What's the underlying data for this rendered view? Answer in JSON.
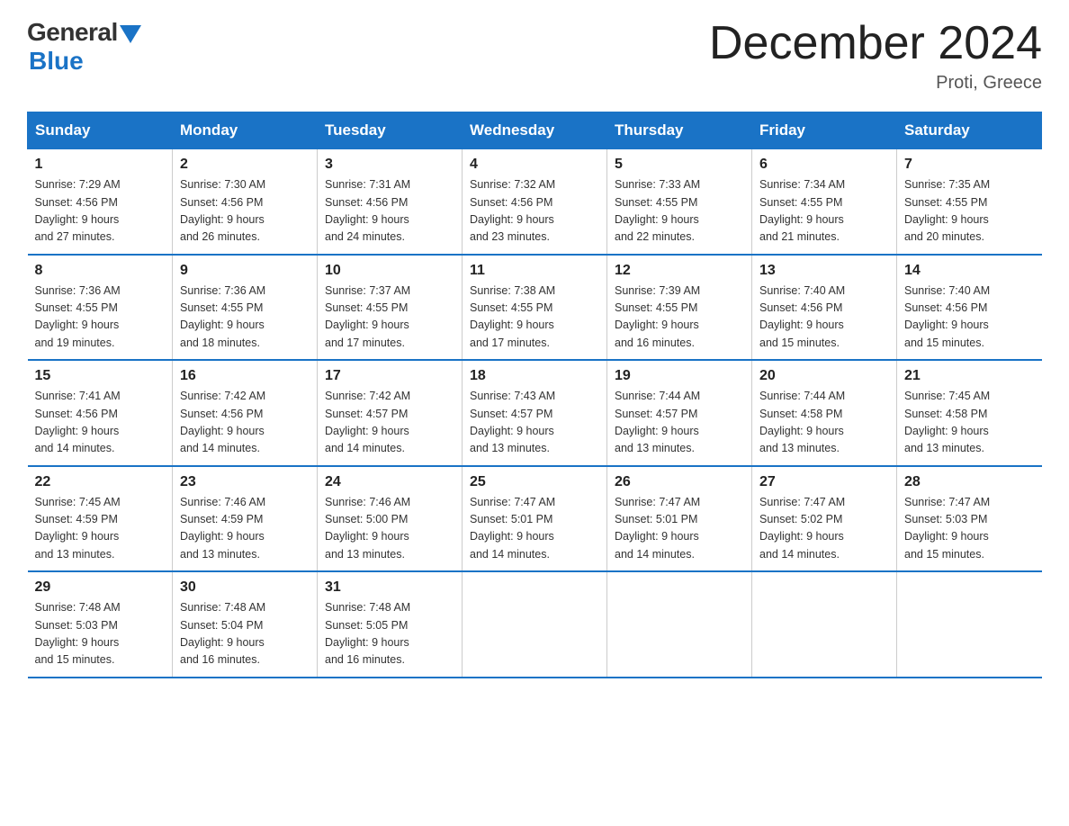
{
  "logo": {
    "general": "General",
    "blue": "Blue"
  },
  "title": "December 2024",
  "location": "Proti, Greece",
  "days_of_week": [
    "Sunday",
    "Monday",
    "Tuesday",
    "Wednesday",
    "Thursday",
    "Friday",
    "Saturday"
  ],
  "weeks": [
    [
      {
        "day": "1",
        "sunrise": "7:29 AM",
        "sunset": "4:56 PM",
        "daylight": "9 hours and 27 minutes."
      },
      {
        "day": "2",
        "sunrise": "7:30 AM",
        "sunset": "4:56 PM",
        "daylight": "9 hours and 26 minutes."
      },
      {
        "day": "3",
        "sunrise": "7:31 AM",
        "sunset": "4:56 PM",
        "daylight": "9 hours and 24 minutes."
      },
      {
        "day": "4",
        "sunrise": "7:32 AM",
        "sunset": "4:56 PM",
        "daylight": "9 hours and 23 minutes."
      },
      {
        "day": "5",
        "sunrise": "7:33 AM",
        "sunset": "4:55 PM",
        "daylight": "9 hours and 22 minutes."
      },
      {
        "day": "6",
        "sunrise": "7:34 AM",
        "sunset": "4:55 PM",
        "daylight": "9 hours and 21 minutes."
      },
      {
        "day": "7",
        "sunrise": "7:35 AM",
        "sunset": "4:55 PM",
        "daylight": "9 hours and 20 minutes."
      }
    ],
    [
      {
        "day": "8",
        "sunrise": "7:36 AM",
        "sunset": "4:55 PM",
        "daylight": "9 hours and 19 minutes."
      },
      {
        "day": "9",
        "sunrise": "7:36 AM",
        "sunset": "4:55 PM",
        "daylight": "9 hours and 18 minutes."
      },
      {
        "day": "10",
        "sunrise": "7:37 AM",
        "sunset": "4:55 PM",
        "daylight": "9 hours and 17 minutes."
      },
      {
        "day": "11",
        "sunrise": "7:38 AM",
        "sunset": "4:55 PM",
        "daylight": "9 hours and 17 minutes."
      },
      {
        "day": "12",
        "sunrise": "7:39 AM",
        "sunset": "4:55 PM",
        "daylight": "9 hours and 16 minutes."
      },
      {
        "day": "13",
        "sunrise": "7:40 AM",
        "sunset": "4:56 PM",
        "daylight": "9 hours and 15 minutes."
      },
      {
        "day": "14",
        "sunrise": "7:40 AM",
        "sunset": "4:56 PM",
        "daylight": "9 hours and 15 minutes."
      }
    ],
    [
      {
        "day": "15",
        "sunrise": "7:41 AM",
        "sunset": "4:56 PM",
        "daylight": "9 hours and 14 minutes."
      },
      {
        "day": "16",
        "sunrise": "7:42 AM",
        "sunset": "4:56 PM",
        "daylight": "9 hours and 14 minutes."
      },
      {
        "day": "17",
        "sunrise": "7:42 AM",
        "sunset": "4:57 PM",
        "daylight": "9 hours and 14 minutes."
      },
      {
        "day": "18",
        "sunrise": "7:43 AM",
        "sunset": "4:57 PM",
        "daylight": "9 hours and 13 minutes."
      },
      {
        "day": "19",
        "sunrise": "7:44 AM",
        "sunset": "4:57 PM",
        "daylight": "9 hours and 13 minutes."
      },
      {
        "day": "20",
        "sunrise": "7:44 AM",
        "sunset": "4:58 PM",
        "daylight": "9 hours and 13 minutes."
      },
      {
        "day": "21",
        "sunrise": "7:45 AM",
        "sunset": "4:58 PM",
        "daylight": "9 hours and 13 minutes."
      }
    ],
    [
      {
        "day": "22",
        "sunrise": "7:45 AM",
        "sunset": "4:59 PM",
        "daylight": "9 hours and 13 minutes."
      },
      {
        "day": "23",
        "sunrise": "7:46 AM",
        "sunset": "4:59 PM",
        "daylight": "9 hours and 13 minutes."
      },
      {
        "day": "24",
        "sunrise": "7:46 AM",
        "sunset": "5:00 PM",
        "daylight": "9 hours and 13 minutes."
      },
      {
        "day": "25",
        "sunrise": "7:47 AM",
        "sunset": "5:01 PM",
        "daylight": "9 hours and 14 minutes."
      },
      {
        "day": "26",
        "sunrise": "7:47 AM",
        "sunset": "5:01 PM",
        "daylight": "9 hours and 14 minutes."
      },
      {
        "day": "27",
        "sunrise": "7:47 AM",
        "sunset": "5:02 PM",
        "daylight": "9 hours and 14 minutes."
      },
      {
        "day": "28",
        "sunrise": "7:47 AM",
        "sunset": "5:03 PM",
        "daylight": "9 hours and 15 minutes."
      }
    ],
    [
      {
        "day": "29",
        "sunrise": "7:48 AM",
        "sunset": "5:03 PM",
        "daylight": "9 hours and 15 minutes."
      },
      {
        "day": "30",
        "sunrise": "7:48 AM",
        "sunset": "5:04 PM",
        "daylight": "9 hours and 16 minutes."
      },
      {
        "day": "31",
        "sunrise": "7:48 AM",
        "sunset": "5:05 PM",
        "daylight": "9 hours and 16 minutes."
      },
      null,
      null,
      null,
      null
    ]
  ],
  "labels": {
    "sunrise": "Sunrise:",
    "sunset": "Sunset:",
    "daylight": "Daylight:"
  }
}
